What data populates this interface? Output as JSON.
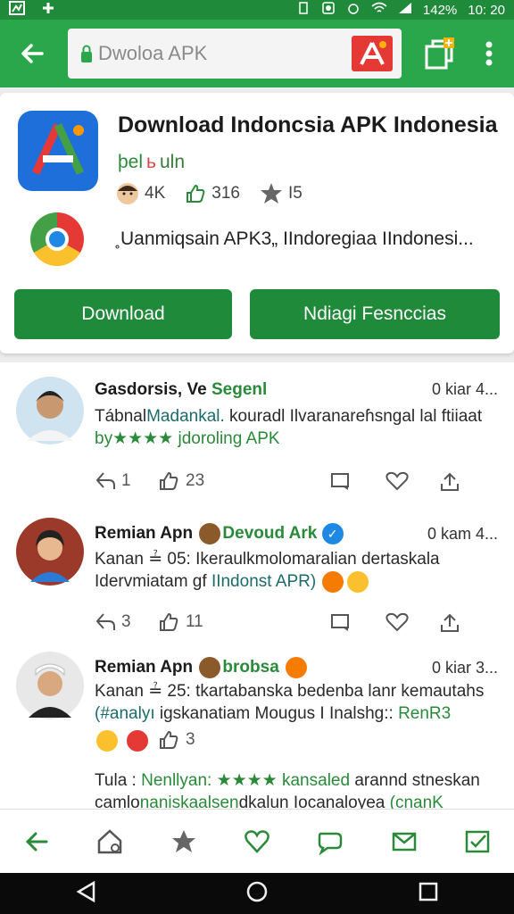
{
  "status_bar": {
    "battery": "142%",
    "time": "10: 20"
  },
  "search": {
    "value": "Dwoloa APK"
  },
  "app": {
    "title": "Download Indoncsia APK Indonesia",
    "dev_part1": "þel",
    "dev_part2": "ь",
    "dev_part3": "uln",
    "stat_users": "4K",
    "stat_likes": "316",
    "stat_rating": "I5",
    "description": "˳Uanmiqsain APK3„ IIndoregiaa IIndonesi...",
    "download_label": "Download",
    "secondary_label": "Ndiagi Fesnccias"
  },
  "posts": [
    {
      "name_a": "Gasdorsis, Ve ",
      "name_b": "Segenl",
      "time": "0 kiar 4...",
      "line1_a": "Tábnal",
      "line1_b": "Madankal.",
      "line1_c": " kouradl Ilvaranareɦsngal lal ftiiaat",
      "line2": "by★★★★ jdoroling APK",
      "reposts": "1",
      "likes": "23"
    },
    {
      "name_a": "Remian Apn",
      "name_b": "Devoud Ark",
      "time": "0 kam 4...",
      "line1": "Kanan ≟ 05: Ikeraulkmolomaralian dertaskala",
      "line2_a": "Idervmiatam gf ",
      "line2_b": "IIndonst APR)",
      "reposts": "3",
      "likes": "11"
    },
    {
      "name_a": "Remian Apn",
      "name_b": "brobsa",
      "time": "0 kiar 3...",
      "line1": "Kanan ≟ 25: tkartabanska bedenba lanr kemautahs",
      "line2_a": "(#analyı ",
      "line2_b": "igskanatiam Mougus I Inalshg:: ",
      "line2_c": "RenR3",
      "likes": "3",
      "line3_a": "Tula : ",
      "line3_b": "Nenllyan: ★★★★ kansaled",
      "line3_c": " arannd stneskan",
      "line4_a": "camlo",
      "line4_b": "naniskaalsen",
      "line4_c": "dkalun Iocanaloyea ",
      "line4_d": "(cnanK"
    }
  ],
  "colors": {
    "primary": "#2aa74a",
    "primary_dark": "#1f8a3a",
    "accent_red": "#e53935"
  }
}
